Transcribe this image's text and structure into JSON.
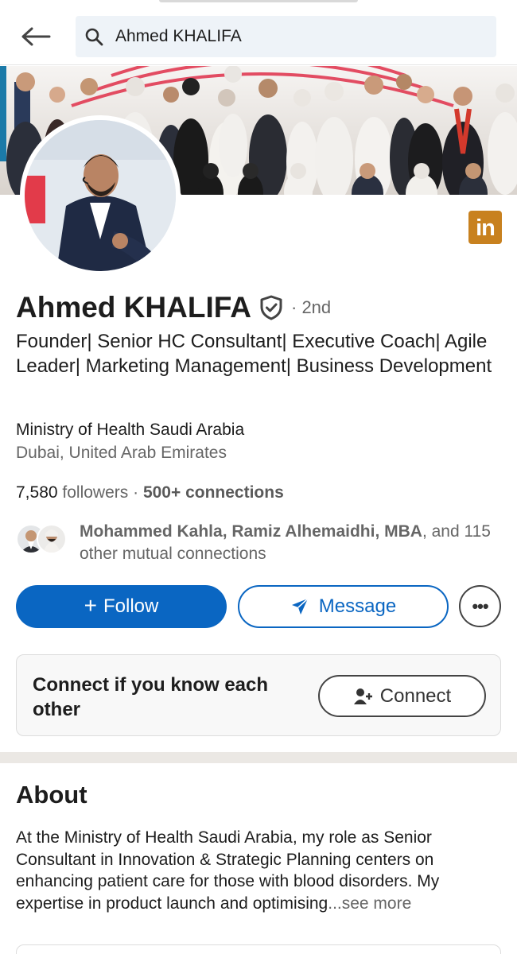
{
  "search": {
    "query": "Ahmed KHALIFA"
  },
  "profile": {
    "name": "Ahmed KHALIFA",
    "degree": "· 2nd",
    "headline": "Founder| Senior HC Consultant| Executive Coach| Agile Leader| Marketing Management| Business Development",
    "company": "Ministry of Health Saudi Arabia",
    "location": "Dubai, United Arab Emirates",
    "followers": "7,580",
    "followers_label": "followers",
    "stats_sep": " · ",
    "connections": "500+ connections",
    "linkedin_badge": "in"
  },
  "mutual": {
    "names": "Mohammed Kahla, Ramiz Alhemaidhi, MBA",
    "rest": ", and 115 other mutual connections"
  },
  "actions": {
    "follow_label": "Follow",
    "follow_plus": "+",
    "message_label": "Message",
    "more_label": "•••",
    "connect_prompt": "Connect if you know each other",
    "connect_label": "Connect"
  },
  "about": {
    "title": "About",
    "text": "At the Ministry of Health Saudi Arabia, my role as Senior Consultant in Innovation & Strategic Planning centers on enhancing patient care for those with blood disorders. My expertise in product launch and optimising",
    "see_more": "...see more"
  },
  "colors": {
    "brand_blue": "#0a66c2",
    "linkedin_badge": "#c8811f",
    "muted_text": "#666666"
  },
  "icons": {
    "back": "arrow-left-icon",
    "search": "search-icon",
    "verified": "shield-check-icon",
    "send": "paper-plane-icon",
    "add_person": "person-add-icon",
    "more": "ellipsis-icon"
  }
}
